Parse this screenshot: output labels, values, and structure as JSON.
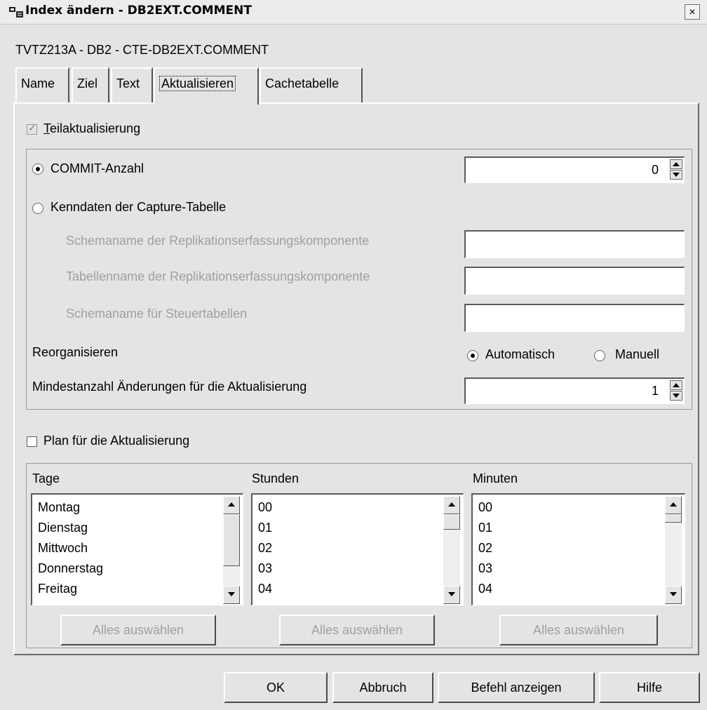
{
  "window": {
    "title": "Index ändern - DB2EXT.COMMENT",
    "close": "×"
  },
  "connection": "TVTZ213A - DB2 - CTE-DB2EXT.COMMENT",
  "tabs": [
    {
      "label": "Name"
    },
    {
      "label": "Ziel"
    },
    {
      "label": "Text"
    },
    {
      "label": "Aktualisieren",
      "active": true
    },
    {
      "label": "Cachetabelle"
    }
  ],
  "update": {
    "partial_update_label": "Teilaktualisierung",
    "partial_update_checked": true,
    "commit_count_label": "COMMIT-Anzahl",
    "commit_count_value": "0",
    "capture_label": "Kenndaten der Capture-Tabelle",
    "capture_schema_label": "Schemaname der Replikationserfassungskomponente",
    "capture_table_label": "Tabellenname der Replikationserfassungskomponente",
    "control_schema_label": "Schemaname für Steuertabellen",
    "reorg_label": "Reorganisieren",
    "reorg_auto_label": "Automatisch",
    "reorg_manual_label": "Manuell",
    "min_changes_label": "Mindestanzahl Änderungen für die Aktualisierung",
    "min_changes_value": "1"
  },
  "schedule": {
    "plan_label": "Plan für die Aktualisierung",
    "plan_checked": false,
    "days": {
      "header": "Tage",
      "items": [
        "Montag",
        "Dienstag",
        "Mittwoch",
        "Donnerstag",
        "Freitag"
      ],
      "select_all": "Alles auswählen"
    },
    "hours": {
      "header": "Stunden",
      "items": [
        "00",
        "01",
        "02",
        "03",
        "04"
      ],
      "select_all": "Alles auswählen"
    },
    "minutes": {
      "header": "Minuten",
      "items": [
        "00",
        "01",
        "02",
        "03",
        "04"
      ],
      "select_all": "Alles auswählen"
    }
  },
  "buttons": {
    "ok": "OK",
    "cancel": "Abbruch",
    "show_command": "Befehl anzeigen",
    "help": "Hilfe"
  },
  "icons": {
    "window": "db-window-icon",
    "close": "close-icon"
  }
}
